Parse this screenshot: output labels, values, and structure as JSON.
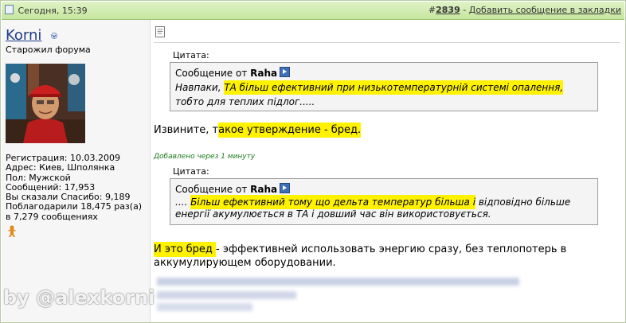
{
  "header": {
    "date": "Сегодня, 15:39",
    "post_hash": "#",
    "post_number": "2839",
    "separator": " - ",
    "bookmark_label": "Добавить сообщение в закладки"
  },
  "user": {
    "name": "Korni",
    "title": "Старожил форума",
    "info": [
      "Регистрация: 10.03.2009",
      "Адрес: Киев, Шполянка",
      "Пол: Мужской",
      "Сообщений: 17,953",
      "Вы сказали Спасибо: 9,189",
      "Поблагодарили 18,475 раз(а)",
      "в 7,279 сообщениях"
    ]
  },
  "post": {
    "quote1": {
      "label": "Цитата:",
      "from_prefix": "Сообщение от ",
      "author": "Raha",
      "line1_prefix": "Навпаки, ",
      "line1_highlight": "ТА більш ефективний при низькотемпературній системі опалення,",
      "line2": "тобто для теплих підлог....."
    },
    "reply1_prefix": "Извините, т",
    "reply1_highlight": "акое утверждение - бред.",
    "added_note": "Добавлено через 1 минуту",
    "quote2": {
      "label": "Цитата:",
      "from_prefix": "Сообщение от ",
      "author": "Raha",
      "line1_prefix": ".... ",
      "line1_highlight": "Більш ефективний тому що дельта температур більша і",
      "line1_rest": " відповідно більше",
      "line2": "енергії акумулюється в ТА і довший час він використовується."
    },
    "reply2_highlight": "И это бред ",
    "reply2_rest": "- эффективней использовать энергию сразу, без теплопотерь в аккумулирующем оборудовании."
  },
  "watermark": "by @alexkorni",
  "colors": {
    "header_bg": "#c6e6a0",
    "highlight": "#fff200",
    "link": "#1f3c88",
    "added_note": "#1a7a1a"
  },
  "icons": [
    "post-doc-icon",
    "user-menu-arrow-icon",
    "view-post-icon",
    "gingerbread-icon",
    "post-icon"
  ]
}
